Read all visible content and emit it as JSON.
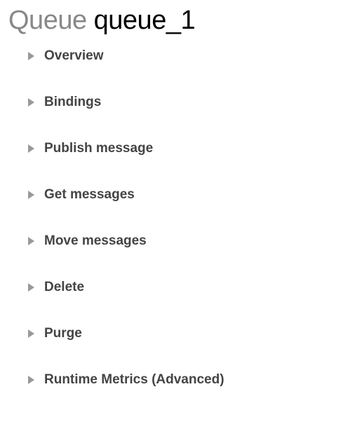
{
  "header": {
    "prefix": "Queue",
    "queue_name": "queue_1"
  },
  "sections": [
    {
      "label": "Overview"
    },
    {
      "label": "Bindings"
    },
    {
      "label": "Publish message"
    },
    {
      "label": "Get messages"
    },
    {
      "label": "Move messages"
    },
    {
      "label": "Delete"
    },
    {
      "label": "Purge"
    },
    {
      "label": "Runtime Metrics (Advanced)"
    }
  ]
}
